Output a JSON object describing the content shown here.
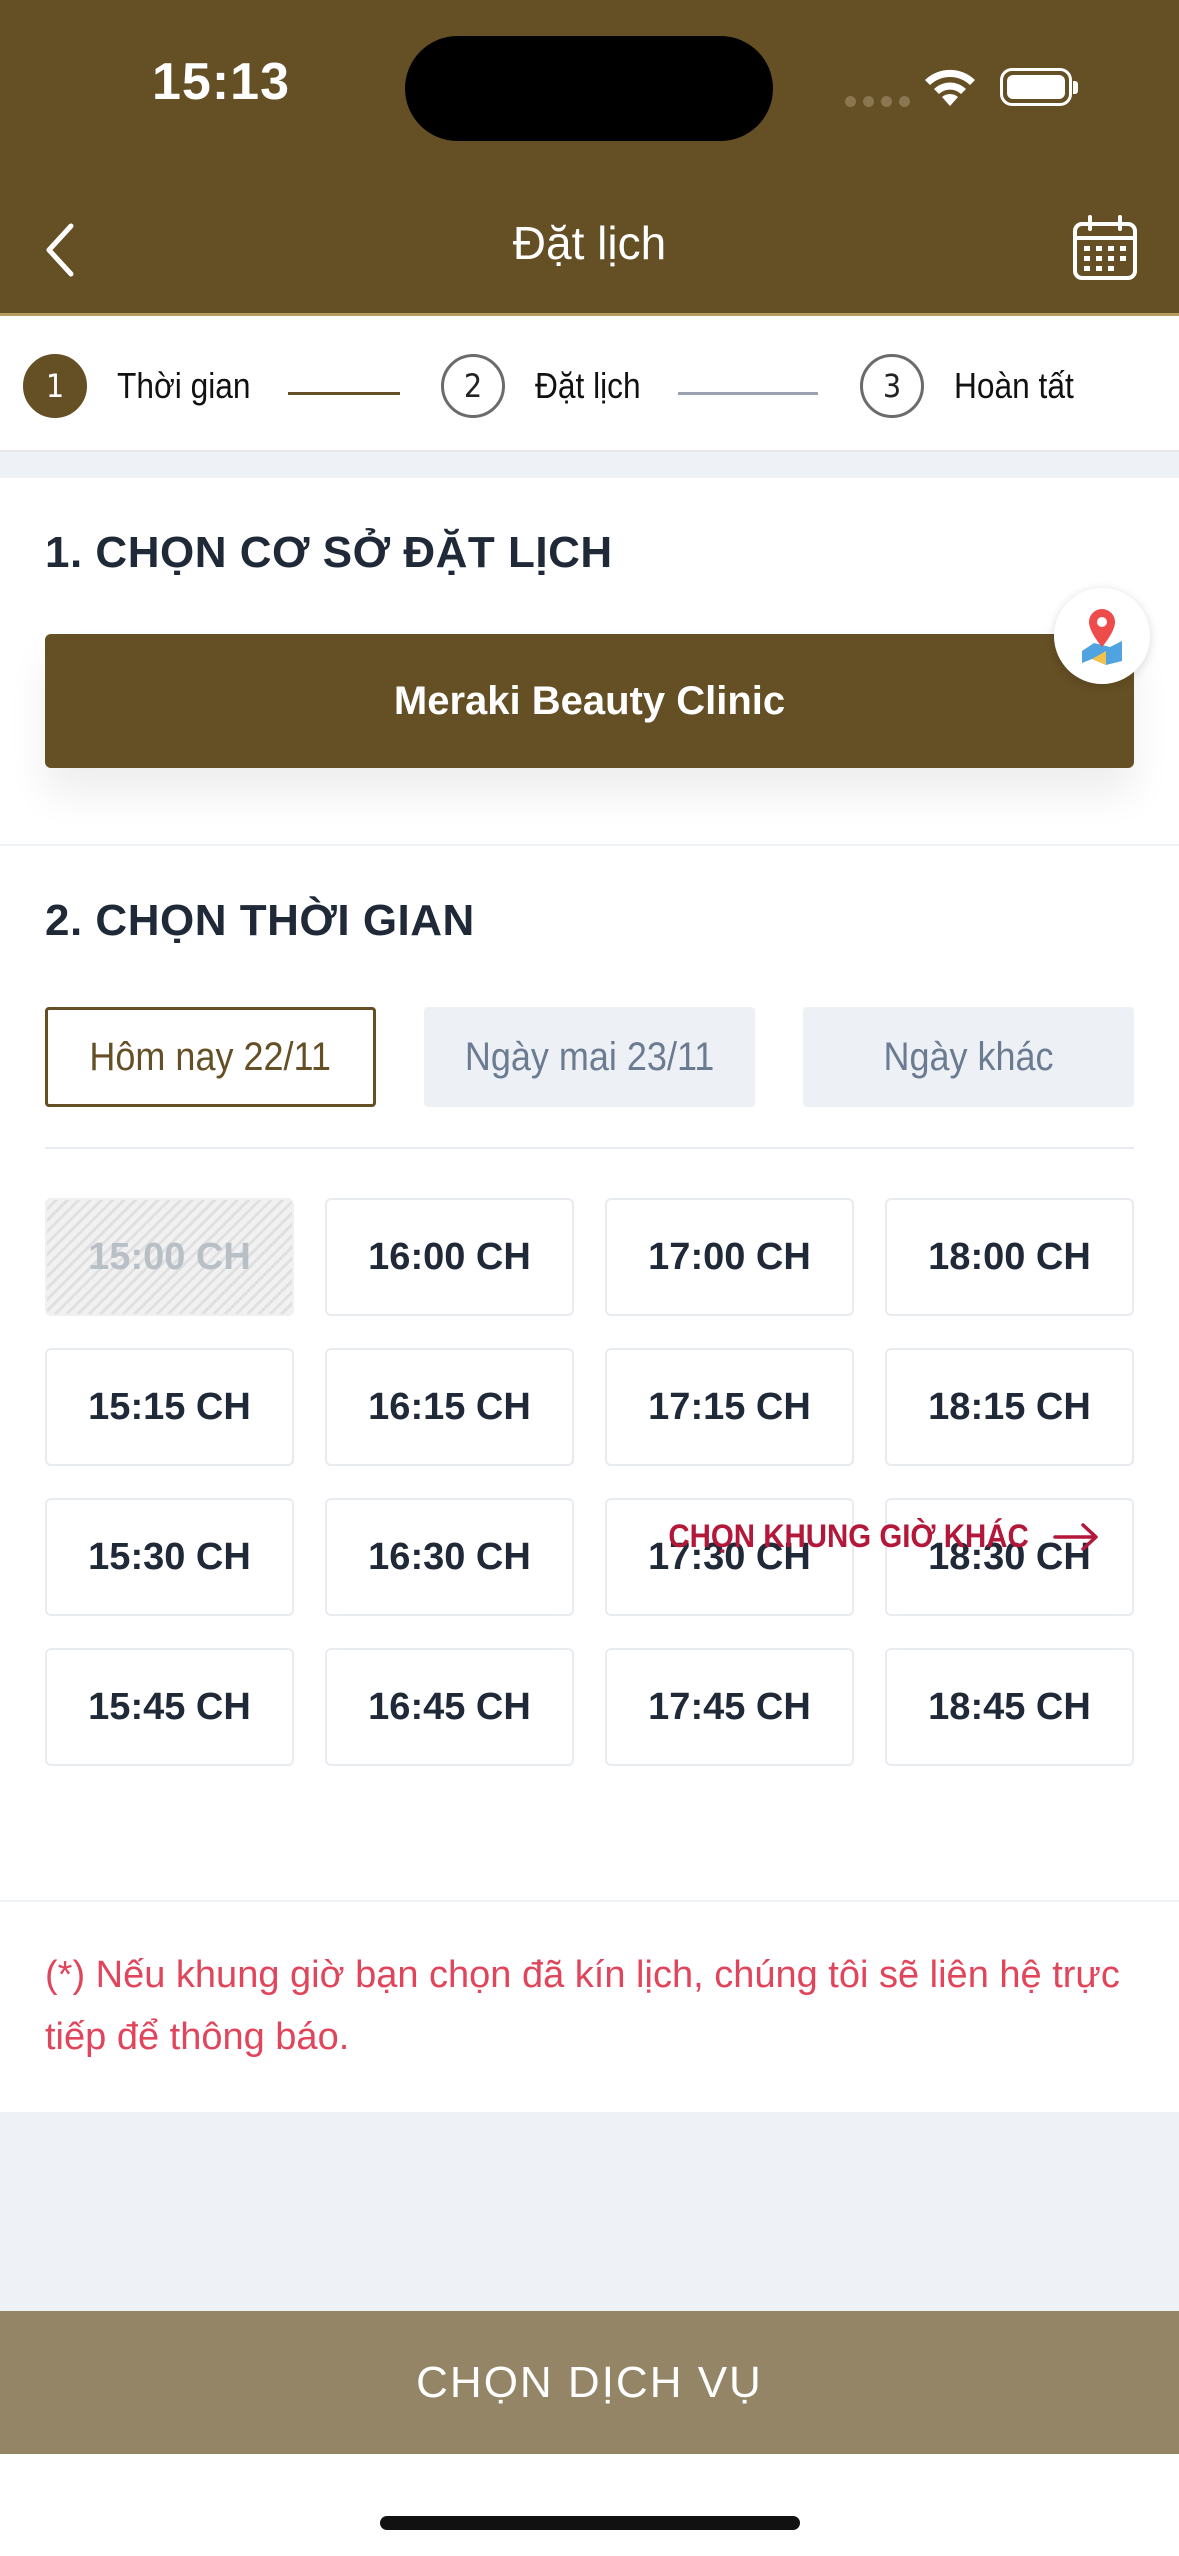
{
  "status_bar": {
    "time": "15:13"
  },
  "header": {
    "title": "Đặt lịch"
  },
  "stepper": {
    "steps": [
      {
        "number": "1",
        "label": "Thời gian"
      },
      {
        "number": "2",
        "label": "Đặt lịch"
      },
      {
        "number": "3",
        "label": "Hoàn tất"
      }
    ]
  },
  "location_section": {
    "title": "1. CHỌN CƠ SỞ ĐẶT LỊCH",
    "clinic_name": "Meraki Beauty Clinic"
  },
  "time_section": {
    "title": "2. CHỌN THỜI GIAN",
    "date_tabs": [
      {
        "label": "Hôm nay 22/11"
      },
      {
        "label": "Ngày mai 23/11"
      },
      {
        "label": "Ngày khác"
      }
    ],
    "slots": [
      "15:00 CH",
      "16:00 CH",
      "17:00 CH",
      "18:00 CH",
      "15:15 CH",
      "16:15 CH",
      "17:15 CH",
      "18:15 CH",
      "15:30 CH",
      "16:30 CH",
      "17:30 CH",
      "18:30 CH",
      "15:45 CH",
      "16:45 CH",
      "17:45 CH",
      "18:45 CH"
    ],
    "more_link": "CHỌN KHUNG GIỜ KHÁC"
  },
  "note": "(*) Nếu khung giờ bạn chọn đã kín lịch, chúng tôi sẽ liên hệ trực tiếp để thông báo.",
  "cta": {
    "label": "CHỌN DỊCH VỤ"
  },
  "colors": {
    "brand": "#654f24",
    "cta": "#938565",
    "accent_red": "#b3173a",
    "note_red": "#e0455b"
  }
}
